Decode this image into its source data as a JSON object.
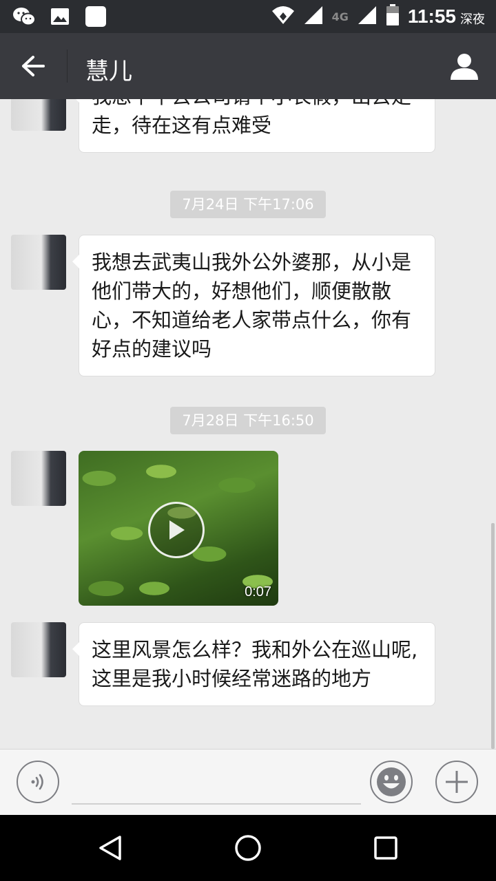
{
  "status_bar": {
    "time": "11:55",
    "period": "深夜",
    "network": "4G",
    "icons": [
      "wechat-icon",
      "image-icon",
      "app-icon",
      "wifi-icon",
      "signal-icon",
      "signal-icon",
      "battery-icon"
    ]
  },
  "header": {
    "title": "慧儿",
    "back_icon": "arrow-left-icon",
    "profile_icon": "person-icon"
  },
  "messages": [
    {
      "type": "text",
      "text": "我想下午去公司请个小长假，出去走走，待在这有点难受"
    },
    {
      "type": "timestamp",
      "text": "7月24日 下午17:06"
    },
    {
      "type": "text",
      "text": "我想去武夷山我外公外婆那，从小是他们带大的，好想他们，顺便散散心，不知道给老人家带点什么，你有好点的建议吗"
    },
    {
      "type": "timestamp",
      "text": "7月28日 下午16:50"
    },
    {
      "type": "video",
      "duration": "0:07"
    },
    {
      "type": "text",
      "text": "这里风景怎么样？我和外公在巡山呢,这里是我小时候经常迷路的地方"
    }
  ],
  "input_bar": {
    "voice_icon": "voice-icon",
    "emoji_icon": "emoji-icon",
    "more_icon": "plus-icon",
    "placeholder": ""
  },
  "colors": {
    "chat_bg": "#ebebeb",
    "header_bg": "#393a3f",
    "statusbar_bg": "#2b2d31",
    "bubble_bg": "#ffffff",
    "timestamp_bg": "#d4d4d4"
  }
}
